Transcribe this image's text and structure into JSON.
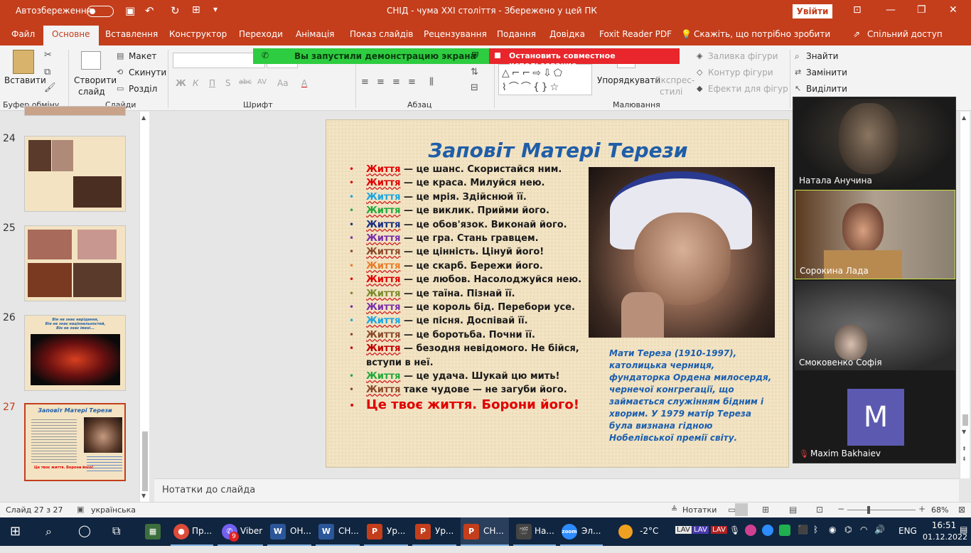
{
  "titlebar": {
    "autosave": "Автозбереження",
    "doc_title": "СНІД - чума ХХІ століття  -  Збережено у цей ПК",
    "signin": "Увійти"
  },
  "tabs": [
    "Файл",
    "Основне",
    "Вставлення",
    "Конструктор",
    "Переходи",
    "Анімація",
    "Показ слайдів",
    "Рецензування",
    "Подання",
    "Довідка",
    "Foxit Reader PDF"
  ],
  "tellme": "Скажіть, що потрібно зробити",
  "share": "Спільний доступ",
  "ribbon": {
    "paste": "Вставити",
    "new_slide_1": "Створити",
    "new_slide_2": "слайд",
    "layout": "Макет",
    "reset": "Скинути",
    "section": "Розділ",
    "clipboard_group": "Буфер обміну",
    "slides_group": "Слайди",
    "font_group": "Шрифт",
    "paragraph_group": "Абзац",
    "drawing_group": "Малювання",
    "arrange": "Упорядкувати",
    "quick_styles_1": "Експрес-",
    "quick_styles_2": "стилі",
    "shape_fill": "Заливка фігури",
    "shape_outline": "Контур фігури",
    "shape_effects": "Ефекти для фігур",
    "find": "Знайти",
    "replace": "Замінити",
    "select": "Виділити",
    "font_buttons": [
      "Ж",
      "К",
      "П",
      "S",
      "abc",
      "AV",
      "Aa",
      "A"
    ]
  },
  "share_banner": {
    "status": "Вы запустили демонстрацию экрана",
    "stop": "Остановить совместное использование"
  },
  "thumbnails": [
    {
      "num": "24"
    },
    {
      "num": "25"
    },
    {
      "num": "26",
      "text": "Він не знає нарідання,\nВін не знає національностей,\nВін не знає імені..."
    },
    {
      "num": "27",
      "title": "Заповіт Матері Терези",
      "footer": "Це твоє життя. Борони його!"
    }
  ],
  "slide": {
    "title": "Заповіт Матері Терези",
    "lines": [
      {
        "word": "Життя",
        "rest": " — це шанс. Скористайся ним.",
        "color": "#e00000"
      },
      {
        "word": "Життя",
        "rest": " — це краса. Милуйся нею.",
        "color": "#e00000"
      },
      {
        "word": "Життя",
        "rest": " — це мрія. Здійснюй її.",
        "color": "#1aa5e0"
      },
      {
        "word": "Життя",
        "rest": " — це виклик. Прийми його.",
        "color": "#22a83a"
      },
      {
        "word": "Життя",
        "rest": " — це обов'язок. Виконай його.",
        "color": "#1a2e80"
      },
      {
        "word": "Життя",
        "rest": " — це гра. Стань гравцем.",
        "color": "#7a2fa8"
      },
      {
        "word": "Життя",
        "rest": " — це цінність. Цінуй його!",
        "color": "#8a4a2a"
      },
      {
        "word": "Життя",
        "rest": " — це скарб. Бережи його.",
        "color": "#e87c2a"
      },
      {
        "word": "Життя",
        "rest": " — це любов. Насолоджуйся нею.",
        "color": "#e00000"
      },
      {
        "word": "Життя",
        "rest": " — це таїна. Пізнай її.",
        "color": "#7a8a2a"
      },
      {
        "word": "Життя",
        "rest": " — це король бід. Перебори усе.",
        "color": "#7a2fa8"
      },
      {
        "word": "Життя",
        "rest": " — це пісня. Доспівай її.",
        "color": "#1aa5e0"
      },
      {
        "word": "Життя",
        "rest": " — це боротьба. Почни її.",
        "color": "#8a4a2a"
      },
      {
        "word": "Життя",
        "rest": " — безодня невідомого. Не бійся,",
        "color": "#c00000"
      },
      {
        "word": "",
        "rest": "вступи в неї.",
        "color": "#c00000"
      },
      {
        "word": "Життя",
        "rest": " — це удача. Шукай цю мить!",
        "color": "#22a83a"
      },
      {
        "word": "Життя",
        "rest": "  таке чудове — не загуби його.",
        "color": "#8a4a2a"
      }
    ],
    "final": "Це твоє життя. Борони його!",
    "caption": "Мати Тереза (1910-1997), католицька черниця, фундаторка Ордена милосердя, чернечої конгрегації, що займається служінням бідним і хворим. У 1979 матір Тереза була визнана гідною Нобелівської премії світу."
  },
  "notes": "Нотатки до слайда",
  "status": {
    "slide_of": "Слайд 27 з 27",
    "language": "українська",
    "notes_btn": "Нотатки",
    "zoom": "68%"
  },
  "zoom_participants": [
    {
      "name": "Натала Анучина"
    },
    {
      "name": "Сорокина Лада"
    },
    {
      "name": "Смоковенко Софія"
    },
    {
      "name": "Maxim Bakhaiev",
      "initial": "M"
    }
  ],
  "taskbar": {
    "items": [
      "Пр...",
      "Viber",
      "ОН...",
      "СН...",
      "Ур...",
      "Ур...",
      "СН...",
      "На...",
      "Эл..."
    ],
    "viber_badge": "9",
    "weather": "-2°C",
    "lang": "ENG",
    "time": "16:51",
    "date": "01.12.2022"
  }
}
